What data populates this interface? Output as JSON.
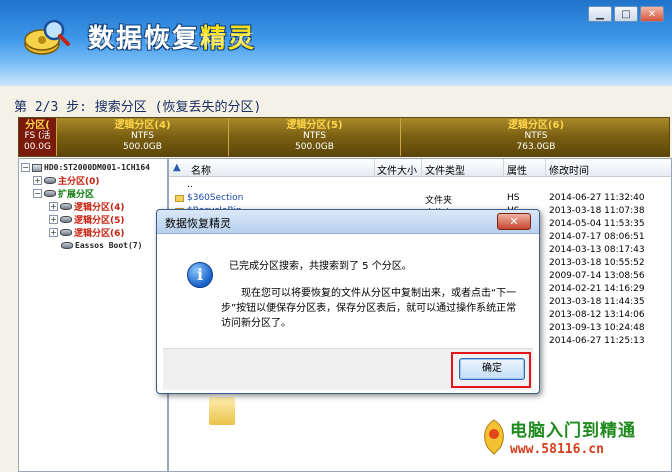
{
  "app": {
    "title_main": "数据恢复",
    "title_accent": "精灵"
  },
  "window_controls": {
    "minimize": "▁",
    "maximize": "□",
    "close": "✕"
  },
  "step": {
    "title": "第 2/3 步: 搜索分区 (恢复丢失的分区)"
  },
  "partition_bar": {
    "first": {
      "name": "分区(",
      "fs": "FS (活",
      "size": "00.0G"
    },
    "segments": [
      {
        "name": "逻辑分区(4)",
        "fs": "NTFS",
        "size": "500.0GB"
      },
      {
        "name": "逻辑分区(5)",
        "fs": "NTFS",
        "size": "500.0GB"
      },
      {
        "name": "逻辑分区(6)",
        "fs": "NTFS",
        "size": "763.0GB"
      }
    ]
  },
  "tree": {
    "disk": "HD0:ST2000DM001-1CH164",
    "primary": "主分区(0)",
    "extended": "扩展分区",
    "logical": [
      "逻辑分区(4)",
      "逻辑分区(5)",
      "逻辑分区(6)"
    ],
    "eassos": "Eassos Boot(7)"
  },
  "file_list": {
    "columns": {
      "name": "名称",
      "size": "文件大小",
      "type": "文件类型",
      "attr": "属性",
      "mtime": "修改时间"
    },
    "rows": [
      {
        "name": "..",
        "type": "",
        "attr": "",
        "mtime": ""
      },
      {
        "name": "$360Section",
        "type": "文件夹",
        "attr": "HS",
        "mtime": "2014-06-27 11:32:40"
      },
      {
        "name": "$RecycleBin",
        "type": "文件夹",
        "attr": "HS",
        "mtime": "2013-03-18 11:07:38"
      },
      {
        "name": "",
        "type": "",
        "attr": "",
        "mtime": "2014-05-04 11:53:35"
      },
      {
        "name": "",
        "type": "",
        "attr": "",
        "mtime": "2014-07-17 08:06:51"
      },
      {
        "name": "",
        "type": "",
        "attr": "",
        "mtime": "2014-03-13 08:17:43"
      },
      {
        "name": "",
        "type": "",
        "attr": "",
        "mtime": "2013-03-18 10:55:52"
      },
      {
        "name": "",
        "type": "",
        "attr": "",
        "mtime": "2009-07-14 13:08:56"
      },
      {
        "name": "",
        "type": "",
        "attr": "",
        "mtime": "2014-02-21 14:16:29"
      },
      {
        "name": "",
        "type": "",
        "attr": "",
        "mtime": "2013-03-18 11:44:35"
      },
      {
        "name": "",
        "type": "",
        "attr": "",
        "mtime": "2013-08-12 13:14:06"
      },
      {
        "name": "",
        "type": "",
        "attr": "",
        "mtime": "2013-09-13 10:24:48"
      },
      {
        "name": "",
        "type": "",
        "attr": "",
        "mtime": "2014-06-27 11:25:13"
      }
    ]
  },
  "dialog": {
    "title": "数据恢复精灵",
    "close": "✕",
    "message_1": "已完成分区搜索，共搜索到了 5 个分区。",
    "message_2": "现在您可以将要恢复的文件从分区中复制出来，或者点击“下一步”按钮以便保存分区表，保存分区表后，就可以通过操作系统正常访问新分区了。",
    "ok": "确定",
    "info_glyph": "i"
  },
  "watermark": {
    "title": "电脑入门到精通",
    "url": "www.58116.cn"
  },
  "colors": {
    "partition_label": "#ffd54a",
    "highlight": "#e1131b",
    "link": "#1e4aa8",
    "tree_primary": "#c62310",
    "tree_extended": "#0b7a0b"
  }
}
